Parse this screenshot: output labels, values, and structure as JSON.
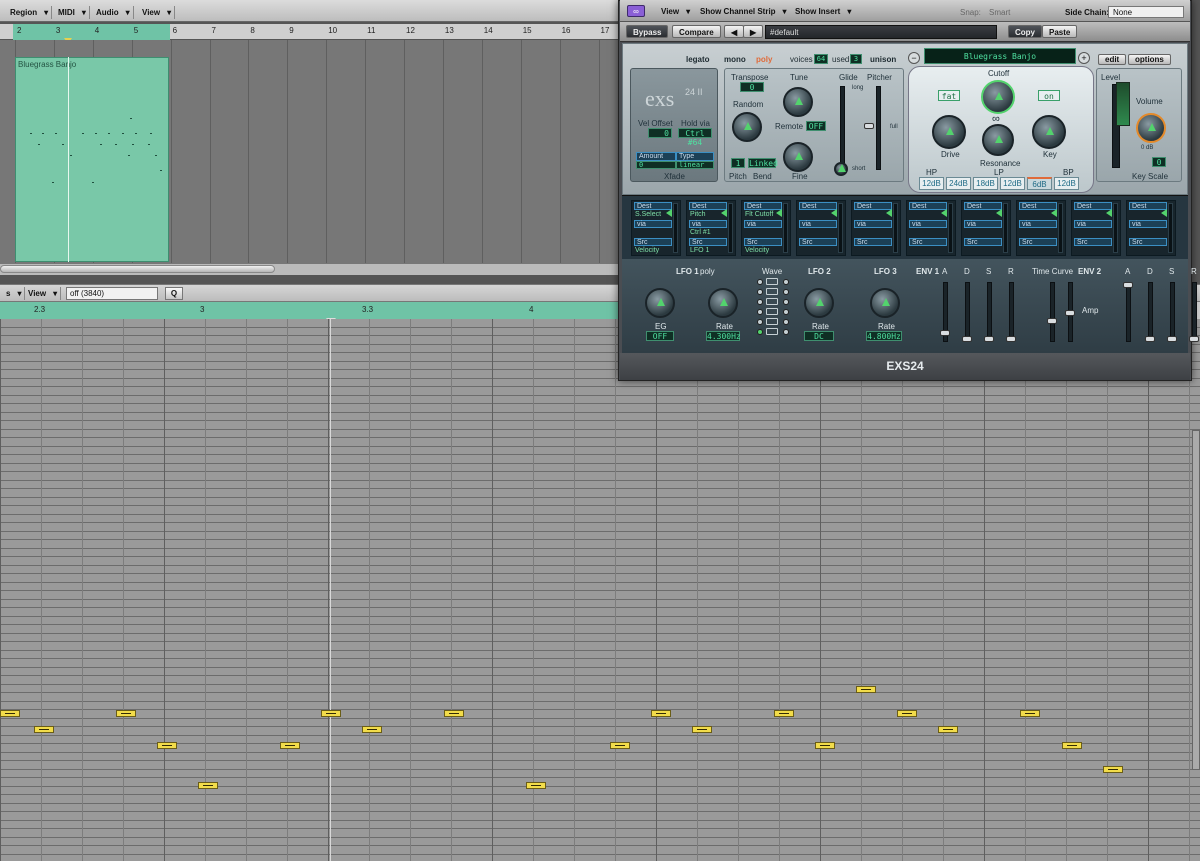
{
  "menu": {
    "region": "Region",
    "midi": "MIDI",
    "audio": "Audio",
    "view": "View"
  },
  "arrange": {
    "bars": [
      "2",
      "3",
      "4",
      "5",
      "6",
      "7",
      "8",
      "9",
      "10",
      "11",
      "12",
      "13",
      "14",
      "15",
      "16",
      "17"
    ],
    "region_name": "Bluegrass Banjo"
  },
  "pianoroll": {
    "toolbar": {
      "view_a": "s",
      "view_b": "View",
      "quantize": "off (3840)",
      "q": "Q"
    },
    "ruler": [
      "2.3",
      "3",
      "3.3",
      "4"
    ]
  },
  "plugin": {
    "header": {
      "view": "View",
      "show_channel_strip": "Show Channel Strip",
      "show_insert": "Show Insert",
      "snap": "Snap:",
      "snap_value": "Smart",
      "side_chain": "Side Chain:",
      "side_chain_value": "None"
    },
    "bar2": {
      "bypass": "Bypass",
      "compare": "Compare",
      "preset": "#default",
      "copy": "Copy",
      "paste": "Paste"
    },
    "mode": {
      "legato": "legato",
      "mono": "mono",
      "poly": "poly",
      "voices": "voices",
      "voices_val": "64",
      "used": "used",
      "used_val": "3",
      "unison": "unison"
    },
    "instrument_name": "Bluegrass Banjo",
    "edit": "edit",
    "options": "options",
    "logo": "exs",
    "logo_sub": "24 II",
    "vel_offset": "Vel Offset",
    "vel_offset_val": "0",
    "hold_via": "Hold via",
    "hold_via_val": "Ctrl #64",
    "xfade": "Xfade",
    "amount": "Amount",
    "type": "Type",
    "xfade_val": "0",
    "xfade_type": "linear",
    "transpose": "Transpose",
    "transpose_val": "0",
    "tune": "Tune",
    "random": "Random",
    "remote": "Remote",
    "remote_val": "OFF",
    "pitch": "Pitch",
    "bend": "Bend",
    "linked": "Linked",
    "pitch_val": "1",
    "fine": "Fine",
    "glide": "Glide",
    "pitcher": "Pitcher",
    "long": "long",
    "short": "short",
    "full": "full",
    "cutoff": "Cutoff",
    "fat": "fat",
    "on": "on",
    "drive": "Drive",
    "resonance": "Resonance",
    "key": "Key",
    "hp": "HP",
    "lp": "LP",
    "bp": "BP",
    "filter_modes": [
      "12dB",
      "24dB",
      "18dB",
      "12dB",
      "6dB",
      "12dB"
    ],
    "level": "Level",
    "volume": "Volume",
    "key_scale": "Key Scale",
    "volume_val": "0 dB",
    "key_scale_val": "0",
    "mod_slots": [
      {
        "dest": "Dest",
        "dest_val": "S.Select",
        "via": "via",
        "src": "Src",
        "src_val": "Velocity"
      },
      {
        "dest": "Dest",
        "dest_val": "Pitch",
        "via": "via",
        "via_val": "Ctrl #1",
        "src": "Src",
        "src_val": "LFO 1"
      },
      {
        "dest": "Dest",
        "dest_val": "Flt Cutoff",
        "via": "via",
        "src": "Src",
        "src_val": "Velocity"
      },
      {
        "dest": "Dest",
        "via": "via",
        "src": "Src"
      },
      {
        "dest": "Dest",
        "via": "via",
        "src": "Src"
      },
      {
        "dest": "Dest",
        "via": "via",
        "src": "Src"
      },
      {
        "dest": "Dest",
        "via": "via",
        "src": "Src"
      },
      {
        "dest": "Dest",
        "via": "via",
        "src": "Src"
      },
      {
        "dest": "Dest",
        "via": "via",
        "src": "Src"
      },
      {
        "dest": "Dest",
        "via": "via",
        "src": "Src"
      }
    ],
    "lfo1": "LFO 1",
    "lfo1_poly": "poly",
    "eg": "EG",
    "eg_val": "OFF",
    "rate": "Rate",
    "lfo1_rate": "4.300Hz",
    "wave": "Wave",
    "lfo2": "LFO 2",
    "lfo2_rate": "DC",
    "lfo3": "LFO 3",
    "lfo3_rate": "4.800Hz",
    "env1": "ENV 1",
    "env2": "ENV 2",
    "time_curve": "Time Curve",
    "amp": "Amp",
    "adsr": [
      "A",
      "D",
      "S",
      "R"
    ],
    "footer": "EXS24"
  }
}
